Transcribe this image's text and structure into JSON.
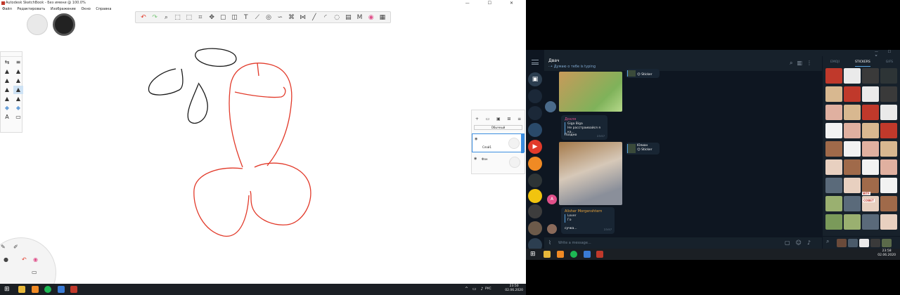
{
  "sketchbook": {
    "title": "Autodesk SketchBook - Без имени @ 100.0%",
    "window_controls": [
      "—",
      "☐",
      "✕"
    ],
    "menu": [
      "Файл",
      "Редактировать",
      "Изображение",
      "Окно",
      "Справка"
    ],
    "toolbar_icons": [
      "undo-icon",
      "redo-icon",
      "zoom-icon",
      "select-icon",
      "lasso-icon",
      "crop-icon",
      "transform-icon",
      "perspective-icon",
      "bucket-icon",
      "text-icon",
      "ruler-icon",
      "ellipse-guide-icon",
      "french-curve-icon",
      "symmetry-icon",
      "distort-icon",
      "line-icon",
      "curve-icon",
      "shape-icon",
      "stroke-icon",
      "copic-icon",
      "color-wheel-icon",
      "color-library-icon"
    ],
    "blend_mode": "Обычный",
    "layers": [
      {
        "name": "Слой1"
      },
      {
        "name": "Фон"
      }
    ]
  },
  "left_taskbar": {
    "time": "23:50",
    "date": "02.06.2020",
    "lang": "РУС"
  },
  "telegram": {
    "chat_name": "Двач",
    "chat_status": "··•  Думаю о тебе is typing",
    "sticker_tabs": [
      "EMOJI",
      "STICKERS",
      "GIFS"
    ],
    "messages": [
      {
        "kind": "reply_sticker",
        "label": "😉 Sticker"
      },
      {
        "kind": "text",
        "sender": "Дохля",
        "quote_name": "Giga Biga",
        "quote_text": "Не расстраивайся я ка...",
        "text": "Поздно",
        "time": "23:57"
      },
      {
        "kind": "reply_sticker",
        "name": "Юлиан",
        "label": "😉 Sticker"
      },
      {
        "kind": "text",
        "sender": "Alisher Morgenshtern",
        "quote_name": "Lover",
        "quote_text": "Го",
        "text": "сучка...",
        "time": "23:57"
      }
    ],
    "avatar_letter": "A",
    "input_placeholder": "Write a message...",
    "sticker_caption_1": "WTF",
    "sticker_caption_2": "СОВЕТ"
  },
  "right_taskbar": {
    "time": "23:58",
    "date": "02.06.2020"
  },
  "colors": {
    "stroke_black": "#1a1a1a",
    "stroke_red": "#e23a2a",
    "tg_bg": "#17212b",
    "tg_dark": "#0e1621",
    "accent": "#5aa4e0"
  }
}
